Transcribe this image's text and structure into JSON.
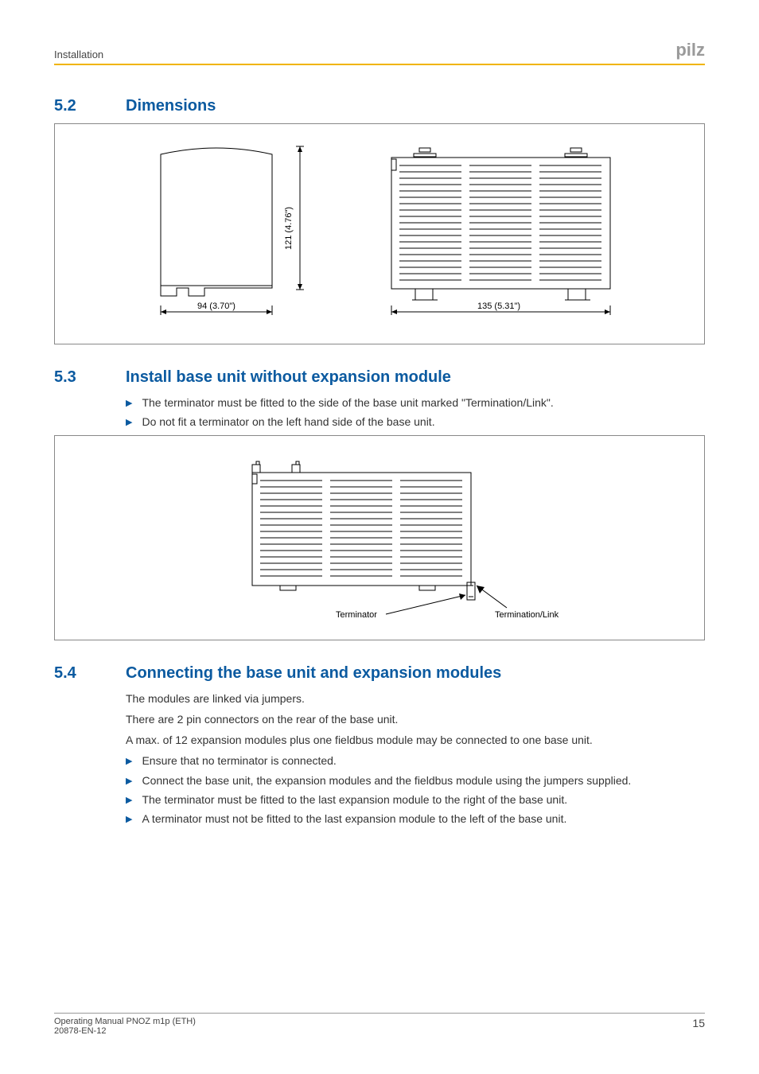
{
  "header": {
    "section": "Installation",
    "logo": "pilz"
  },
  "sections": {
    "s1": {
      "num": "5.2",
      "title": "Dimensions"
    },
    "s2": {
      "num": "5.3",
      "title": "Install base unit without expansion module"
    },
    "s3": {
      "num": "5.4",
      "title": "Connecting the base unit and expansion modules"
    }
  },
  "fig1": {
    "height_dim": "121 (4.76\")",
    "width_side_dim": "94 (3.70\")",
    "width_front_dim": "135 (5.31\")"
  },
  "s2_bullets": {
    "b1": "The terminator must be fitted to the side of the base unit marked \"Termination/Link\".",
    "b2": "Do not fit a terminator on the left hand side of the base unit."
  },
  "fig2": {
    "label_terminator": "Terminator",
    "label_termination_link": "Termination/Link"
  },
  "s3_paras": {
    "p1": "The modules are linked via jumpers.",
    "p2": "There are 2 pin connectors on the rear of the base unit.",
    "p3": "A max. of 12 expansion modules plus one fieldbus module may be connected to one base unit."
  },
  "s3_bullets": {
    "b1": "Ensure that no terminator is connected.",
    "b2": "Connect the base unit, the expansion modules and the fieldbus module using the jumpers supplied.",
    "b3": "The terminator must be fitted to the last expansion module to the right of the base unit.",
    "b4": "A terminator must not be fitted to the last expansion module to the left of the base unit."
  },
  "footer": {
    "line1": "Operating Manual PNOZ m1p (ETH)",
    "line2": "20878-EN-12",
    "page": "15"
  }
}
